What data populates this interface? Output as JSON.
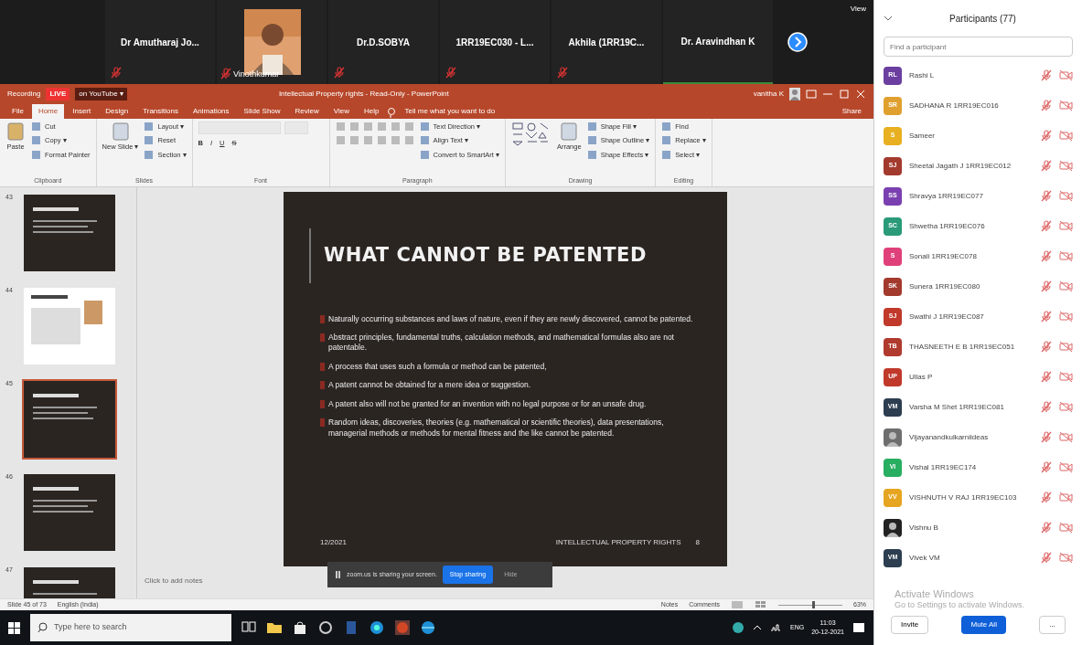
{
  "meeting": {
    "video_tiles": [
      {
        "kind": "name",
        "name": "Dr Amutharaj Jo...",
        "muted": true
      },
      {
        "kind": "video",
        "name": "Vinothkumar",
        "muted": true
      },
      {
        "kind": "name",
        "name": "Dr.D.SOBYA",
        "muted": true
      },
      {
        "kind": "name",
        "name": "1RR19EC030 - L...",
        "muted": true
      },
      {
        "kind": "name",
        "name": "Akhila (1RR19C...",
        "muted": true
      },
      {
        "kind": "name",
        "name": "Dr. Aravindhan K",
        "muted": false
      }
    ],
    "view_label": "View"
  },
  "powerpoint": {
    "recording": "Recording",
    "live": "LIVE",
    "live_target": "on YouTube ▾",
    "title": "Intellectual Property rights - Read-Only - PowerPoint",
    "user": "vanitha K",
    "tabs": [
      {
        "label": "File",
        "selected": false
      },
      {
        "label": "Home",
        "selected": true
      },
      {
        "label": "Insert",
        "selected": false
      },
      {
        "label": "Design",
        "selected": false
      },
      {
        "label": "Transitions",
        "selected": false
      },
      {
        "label": "Animations",
        "selected": false
      },
      {
        "label": "Slide Show",
        "selected": false
      },
      {
        "label": "Review",
        "selected": false
      },
      {
        "label": "View",
        "selected": false
      },
      {
        "label": "Help",
        "selected": false
      }
    ],
    "tell_me": "Tell me what you want to do",
    "share": "Share",
    "ribbon_groups": [
      {
        "label": "Clipboard",
        "big": "Paste",
        "items": [
          "Cut",
          "Copy ▾",
          "Format Painter"
        ]
      },
      {
        "label": "Slides",
        "big": "New Slide ▾",
        "items": [
          "Layout ▾",
          "Reset",
          "Section ▾"
        ]
      },
      {
        "label": "Font"
      },
      {
        "label": "Paragraph",
        "items": [
          "Text Direction ▾",
          "Align Text ▾",
          "Convert to SmartArt ▾"
        ]
      },
      {
        "label": "Drawing",
        "big": "Arrange",
        "items": [
          "Shape Fill ▾",
          "Shape Outline ▾",
          "Shape Effects ▾"
        ]
      },
      {
        "label": "Editing",
        "items": [
          "Find",
          "Replace ▾",
          "Select ▾"
        ]
      }
    ],
    "font_buttons": [
      "B",
      "I",
      "U",
      "S"
    ],
    "thumbnails": [
      {
        "number": "43",
        "kind": "dark",
        "selected": false
      },
      {
        "number": "44",
        "kind": "light",
        "selected": false
      },
      {
        "number": "45",
        "kind": "dark",
        "selected": true
      },
      {
        "number": "46",
        "kind": "dark",
        "selected": false
      },
      {
        "number": "47",
        "kind": "dark",
        "selected": false
      }
    ],
    "slide": {
      "title": "WHAT CANNOT BE PATENTED",
      "bullets": [
        "Naturally occurring substances and laws of nature, even if they are newly discovered, cannot be patented.",
        "Abstract principles, fundamental truths, calculation methods, and mathematical formulas also are not patentable.",
        "A process that uses such a formula or method can be patented,",
        "A patent cannot be obtained for a mere idea or suggestion.",
        "A patent also will not be granted for an invention with no legal purpose or for an unsafe drug.",
        "Random ideas, discoveries, theories (e.g. mathematical or scientific theories), data presentations, managerial methods or methods for mental fitness and the like cannot be patented."
      ],
      "footer_left": "12/2021",
      "footer_right": "INTELLECTUAL PROPERTY RIGHTS",
      "footer_page": "8"
    },
    "notes_placeholder": "Click to add notes",
    "status": {
      "slide_count": "Slide 45 of 73",
      "language": "English (India)",
      "notes": "Notes",
      "comments": "Comments",
      "zoom": "63%",
      "zoom_level": {
        "level": 0.55
      }
    }
  },
  "share_bar": {
    "message": "zoom.us is sharing your screen.",
    "stop": "Stop sharing",
    "hide": "Hide"
  },
  "taskbar": {
    "search_placeholder": "Type here to search",
    "lang": "ENG",
    "time": "11:03",
    "date": "20-12-2021"
  },
  "participants": {
    "title": "Participants (77)",
    "search_placeholder": "Find a participant",
    "people": [
      {
        "initials": "RL",
        "name": "Rashi L",
        "color": "#6b3fa0",
        "kind": "initials",
        "muted": true
      },
      {
        "initials": "SR",
        "name": "SADHANA R 1RR19EC016",
        "color": "#e0a030",
        "kind": "initials",
        "muted": true
      },
      {
        "initials": "S",
        "name": "Sameer",
        "color": "#e8b020",
        "kind": "initials",
        "muted": true
      },
      {
        "initials": "SJ",
        "name": "Sheetal Jagath J 1RR19EC012",
        "color": "#a33a2e",
        "kind": "initials",
        "muted": true
      },
      {
        "initials": "SS",
        "name": "Shravya 1RR19EC077",
        "color": "#7a3fb0",
        "kind": "initials",
        "muted": true
      },
      {
        "initials": "SC",
        "name": "Shwetha 1RR19EC076",
        "color": "#2a9a78",
        "kind": "initials",
        "muted": true
      },
      {
        "initials": "S",
        "name": "Sonali 1RR19EC078",
        "color": "#e0407a",
        "kind": "initials",
        "muted": true
      },
      {
        "initials": "SK",
        "name": "Sunera 1RR19EC080",
        "color": "#a33a2e",
        "kind": "initials",
        "muted": true
      },
      {
        "initials": "SJ",
        "name": "Swathi J 1RR19EC087",
        "color": "#c0392b",
        "kind": "initials",
        "muted": true
      },
      {
        "initials": "TB",
        "name": "THASNEETH E B 1RR19EC051",
        "color": "#b03a2e",
        "kind": "initials",
        "muted": true
      },
      {
        "initials": "UP",
        "name": "Ullas P",
        "color": "#c0392b",
        "kind": "initials",
        "muted": true
      },
      {
        "initials": "VM",
        "name": "Varsha M Shet 1RR19EC081",
        "color": "#2c3e50",
        "kind": "initials",
        "muted": true
      },
      {
        "name": "Vijayanandkulkarniideas",
        "color": "#6e6e6e",
        "muted": true
      },
      {
        "initials": "VI",
        "name": "Vishal 1RR19EC174",
        "color": "#27ae60",
        "kind": "initials",
        "muted": true
      },
      {
        "initials": "VV",
        "name": "VISHNUTH V RAJ 1RR19EC103",
        "color": "#e6a520",
        "kind": "initials",
        "muted": true
      },
      {
        "name": "Vishnu B",
        "color": "#222222",
        "muted": true
      },
      {
        "initials": "VM",
        "name": "Vivek VM",
        "color": "#2c3e50",
        "kind": "initials",
        "muted": true
      }
    ],
    "os_notice": [
      "Activate Windows",
      "Go to Settings to activate Windows."
    ],
    "invite": "Invite",
    "mute_all": "Mute All",
    "more": "..."
  }
}
